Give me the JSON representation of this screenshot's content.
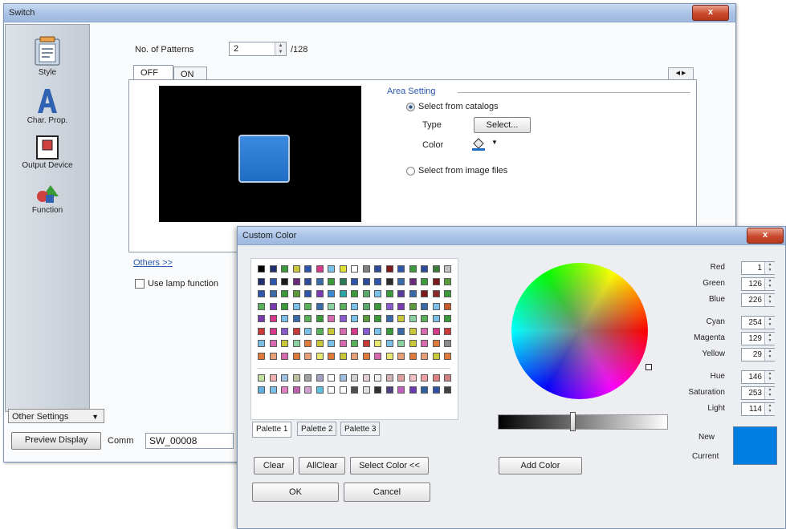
{
  "switch_window": {
    "title": "Switch",
    "close_label": "x",
    "sidebar": {
      "items": [
        {
          "label": "Style",
          "icon": "clipboard-icon"
        },
        {
          "label": "Char. Prop.",
          "icon": "letter-a-icon"
        },
        {
          "label": "Output Device",
          "icon": "output-device-icon"
        },
        {
          "label": "Function",
          "icon": "shapes-icon"
        }
      ],
      "other_settings": "Other Settings"
    },
    "patterns": {
      "label": "No. of Patterns",
      "value": "2",
      "max": "/128"
    },
    "tabs": [
      "OFF",
      "ON"
    ],
    "area_setting": {
      "title": "Area Setting",
      "option_catalog": "Select from catalogs",
      "type_label": "Type",
      "select_button": "Select...",
      "color_label": "Color",
      "option_image": "Select from image files"
    },
    "others_link": "Others >>",
    "use_lamp": "Use lamp function",
    "preview_button": "Preview Display",
    "comment_label": "Comm",
    "comment_value": "SW_00008",
    "preview_color": "#1f6dc4"
  },
  "custom_color": {
    "title": "Custom Color",
    "close_label": "x",
    "palette_tabs": [
      "Palette 1",
      "Palette 2",
      "Palette 3"
    ],
    "buttons": {
      "clear": "Clear",
      "all_clear": "AllClear",
      "select_color": "Select Color <<",
      "ok": "OK",
      "cancel": "Cancel",
      "add_color": "Add Color"
    },
    "values": [
      {
        "label": "Red",
        "value": "1"
      },
      {
        "label": "Green",
        "value": "126"
      },
      {
        "label": "Blue",
        "value": "226"
      },
      {
        "label": "Cyan",
        "value": "254"
      },
      {
        "label": "Magenta",
        "value": "129"
      },
      {
        "label": "Yellow",
        "value": "29"
      },
      {
        "label": "Hue",
        "value": "146"
      },
      {
        "label": "Saturation",
        "value": "253"
      },
      {
        "label": "Light",
        "value": "114"
      }
    ],
    "new_label": "New",
    "current_label": "Current",
    "current_color": "#017ee2",
    "palette_rows": [
      [
        "#000000",
        "#1f2f6f",
        "#3b9a3b",
        "#c8c83a",
        "#2d54a8",
        "#d43a8a",
        "#7bc0e8",
        "#e0e030",
        "#ffffff",
        "#808080",
        "#304a9a",
        "#7a1a1a",
        "#2d54a8",
        "#3b9a3b",
        "#304a9a",
        "#3b7a3b",
        "#c0c0c0"
      ],
      [
        "#1f2f6f",
        "#2d54a8",
        "#1a1a1a",
        "#6a2a7a",
        "#304a9a",
        "#3b6aa8",
        "#3b9a3b",
        "#2b7a5a",
        "#2d54a8",
        "#304a9a",
        "#2d54a8",
        "#2a2a2a",
        "#3b6aa8",
        "#6a2a7a",
        "#3b9a3b",
        "#7a1a1a",
        "#5a9a3a"
      ],
      [
        "#2d54a8",
        "#3b6aa8",
        "#3b9a3b",
        "#5a9a3a",
        "#2d54a8",
        "#7a3ab0",
        "#3a8ad0",
        "#2aa8a8",
        "#3b9a3b",
        "#5aa86a",
        "#7ac0e8",
        "#3b9a3b",
        "#5a3aa0",
        "#3b6aa8",
        "#7a1a1a",
        "#8a2a2a",
        "#3b9a3b"
      ],
      [
        "#5ab05a",
        "#7a3ab0",
        "#3b9a3b",
        "#7ac0e8",
        "#5ab05a",
        "#3b6aa8",
        "#8ad0a0",
        "#5ab05a",
        "#7ac0e8",
        "#5aa86a",
        "#3b9a3b",
        "#8a5ad0",
        "#7a3ab0",
        "#5a9a3a",
        "#3b6aa8",
        "#7ac0e8",
        "#c85a2a"
      ],
      [
        "#7a3ab0",
        "#d43a8a",
        "#7ac0e8",
        "#3b6aa8",
        "#5ab05a",
        "#3b9a3b",
        "#d86ab0",
        "#8a5ad0",
        "#7ac0e8",
        "#5a9a3a",
        "#3b9a3b",
        "#3b6aa8",
        "#c8c83a",
        "#8ad0a0",
        "#5ab05a",
        "#7ac0e8",
        "#3b9a3b"
      ],
      [
        "#c83a3a",
        "#d43a8a",
        "#8a5ad0",
        "#c83a3a",
        "#7ac0e8",
        "#5ab05a",
        "#c8c83a",
        "#d86ab0",
        "#d43a8a",
        "#8a5ad0",
        "#7ac0e8",
        "#3b9a3b",
        "#3b6aa8",
        "#c8c83a",
        "#d86ab0",
        "#d43a8a",
        "#c83a3a"
      ],
      [
        "#7ac0e8",
        "#d86ab0",
        "#c8c83a",
        "#8ad0a0",
        "#e07a3a",
        "#c8c83a",
        "#7ac0e8",
        "#d86ab0",
        "#5ab05a",
        "#c83a3a",
        "#e8e870",
        "#7ac0e8",
        "#8ad0a0",
        "#c8c83a",
        "#d86ab0",
        "#e07a3a",
        "#8a8a8a"
      ],
      [
        "#e07a3a",
        "#e8a07a",
        "#d86ab0",
        "#e07a3a",
        "#e8a07a",
        "#e8e870",
        "#e07a3a",
        "#c8c83a",
        "#e8a07a",
        "#e07a3a",
        "#d86ab0",
        "#e8e870",
        "#e8a07a",
        "#e07a3a",
        "#e8a07a",
        "#c8c83a",
        "#e07a3a"
      ]
    ],
    "custom_rows": [
      [
        "#c0e0a0",
        "#f0b0b0",
        "#a0c0e0",
        "#c0c0a0",
        "#a0a0a0",
        "#a0a0c0",
        "#ffffff",
        "#a0c0e0",
        "#d0d0d0",
        "#e0d0d0",
        "#f0f0f0",
        "#d0b0b0",
        "#e0a0a0",
        "#f0c0c0",
        "#f0a0a0",
        "#e08080",
        "#d08080"
      ],
      [
        "#60b0e0",
        "#7ac0e8",
        "#e080c0",
        "#c060b0",
        "#d0a0d0",
        "#60c0e0",
        "#ffffff",
        "#ffffff",
        "#505050",
        "#e0e0e0",
        "#303030",
        "#504080",
        "#c060c0",
        "#6a3ab0",
        "#3060a0",
        "#3050a0",
        "#404040"
      ]
    ]
  }
}
